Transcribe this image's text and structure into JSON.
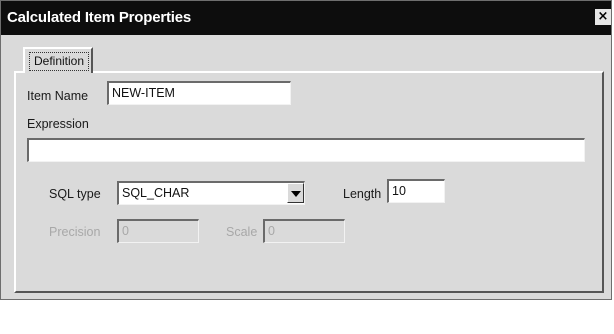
{
  "window": {
    "title": "Calculated Item Properties",
    "close_label": "×"
  },
  "tabs": [
    {
      "label": "Definition",
      "active": true
    }
  ],
  "form": {
    "item_name_label": "Item Name",
    "item_name_value": "NEW-ITEM",
    "expression_label": "Expression",
    "expression_value": "",
    "sql_type_label": "SQL type",
    "sql_type_value": "SQL_CHAR",
    "length_label": "Length",
    "length_value": "10",
    "precision_label": "Precision",
    "precision_value": "0",
    "scale_label": "Scale",
    "scale_value": "0"
  },
  "icons": {
    "close": "close-icon",
    "dropdown": "chevron-down-icon"
  },
  "colors": {
    "titlebar": "#0d0d0d",
    "dialog_face": "#dadada",
    "disabled_text": "#a8a8a8"
  }
}
